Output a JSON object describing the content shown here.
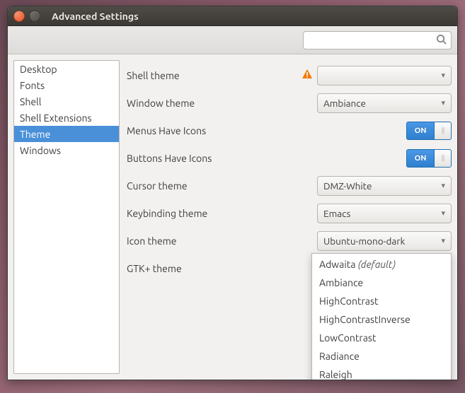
{
  "window": {
    "title": "Advanced Settings"
  },
  "search": {
    "placeholder": ""
  },
  "sidebar": {
    "items": [
      {
        "label": "Desktop"
      },
      {
        "label": "Fonts"
      },
      {
        "label": "Shell"
      },
      {
        "label": "Shell Extensions"
      },
      {
        "label": "Theme",
        "selected": true
      },
      {
        "label": "Windows"
      }
    ]
  },
  "rows": {
    "shell_theme": {
      "label": "Shell theme",
      "value": ""
    },
    "window_theme": {
      "label": "Window theme",
      "value": "Ambiance"
    },
    "menus_icons": {
      "label": "Menus Have Icons",
      "switch": "ON"
    },
    "buttons_icons": {
      "label": "Buttons Have Icons",
      "switch": "ON"
    },
    "cursor_theme": {
      "label": "Cursor theme",
      "value": "DMZ-White"
    },
    "keybinding_theme": {
      "label": "Keybinding theme",
      "value": "Emacs"
    },
    "icon_theme": {
      "label": "Icon theme",
      "value": "Ubuntu-mono-dark"
    },
    "gtk_theme": {
      "label": "GTK+ theme",
      "value": ""
    }
  },
  "gtk_dropdown": {
    "items": [
      {
        "label": "Adwaita",
        "suffix": "(default)"
      },
      {
        "label": "Ambiance"
      },
      {
        "label": "HighContrast"
      },
      {
        "label": "HighContrastInverse"
      },
      {
        "label": "LowContrast"
      },
      {
        "label": "Radiance"
      },
      {
        "label": "Raleigh"
      }
    ]
  }
}
